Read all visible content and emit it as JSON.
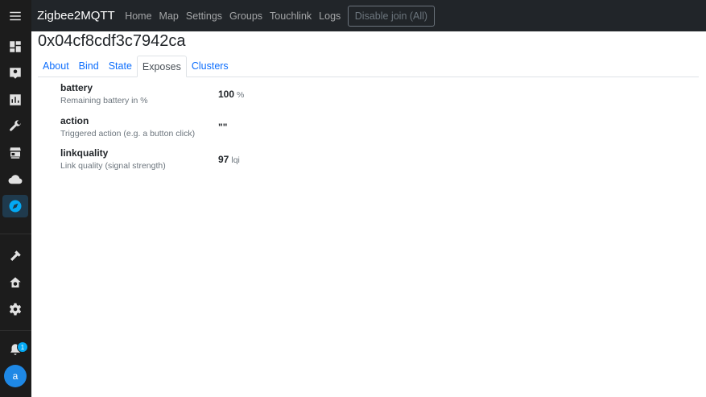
{
  "header": {
    "brand": "Zigbee2MQTT",
    "nav": [
      "Home",
      "Map",
      "Settings",
      "Groups",
      "Touchlink",
      "Logs"
    ],
    "disable_join_label": "Disable join (All)"
  },
  "device": {
    "title": "0x04cf8cdf3c7942ca"
  },
  "tabs": [
    {
      "label": "About",
      "active": false
    },
    {
      "label": "Bind",
      "active": false
    },
    {
      "label": "State",
      "active": false
    },
    {
      "label": "Exposes",
      "active": true
    },
    {
      "label": "Clusters",
      "active": false
    }
  ],
  "exposes": [
    {
      "name": "battery",
      "description": "Remaining battery in %",
      "value": "100",
      "unit": "%"
    },
    {
      "name": "action",
      "description": "Triggered action (e.g. a button click)",
      "value": "\"\"",
      "unit": ""
    },
    {
      "name": "linkquality",
      "description": "Link quality (signal strength)",
      "value": "97",
      "unit": "lqi"
    }
  ],
  "sidebar": {
    "notification_count": "1",
    "user_initial": "a",
    "items": [
      "menu-icon",
      "dashboard-icon",
      "person-icon",
      "chart-icon",
      "wrench-icon",
      "hacs-store-icon",
      "cloud-icon",
      "compass-icon",
      "hammer-icon",
      "home-cog-icon",
      "gear-icon",
      "bell-icon"
    ]
  },
  "colors": {
    "topbar": "#212529",
    "sidebar": "#1c1c1c",
    "link": "#0d6efd",
    "accent": "#03a9f4"
  }
}
